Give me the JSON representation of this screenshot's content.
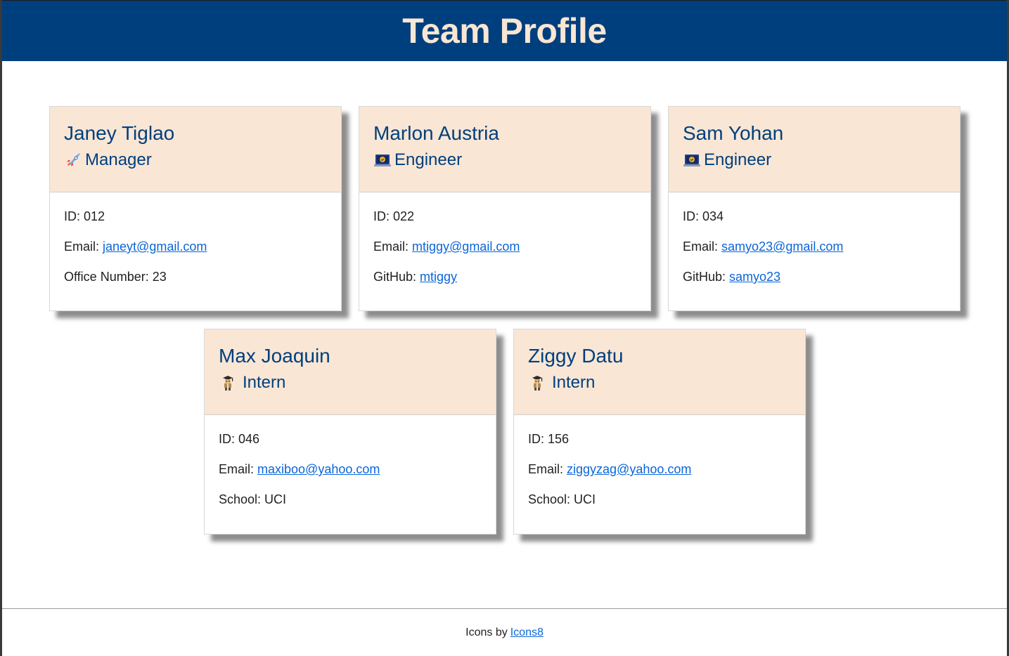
{
  "header": {
    "title": "Team Profile"
  },
  "cards": [
    {
      "name": "Janey Tiglao",
      "role": "Manager",
      "icon": "rocket-icon",
      "id_label": "ID: ",
      "id": "012",
      "email_label": "Email: ",
      "email": "janeyt@gmail.com",
      "extra_label": "Office Number: ",
      "extra": "23"
    },
    {
      "name": "Marlon Austria",
      "role": "Engineer",
      "icon": "laptop-icon",
      "id_label": "ID: ",
      "id": "022",
      "email_label": "Email: ",
      "email": "mtiggy@gmail.com",
      "extra_label": "GitHub: ",
      "extra": "mtiggy"
    },
    {
      "name": "Sam Yohan",
      "role": "Engineer",
      "icon": "laptop-icon",
      "id_label": "ID: ",
      "id": "034",
      "email_label": "Email: ",
      "email": "samyo23@gmail.com",
      "extra_label": "GitHub: ",
      "extra": "samyo23"
    },
    {
      "name": "Max Joaquin",
      "role": "Intern",
      "icon": "graduate-icon",
      "id_label": "ID: ",
      "id": "046",
      "email_label": "Email: ",
      "email": "maxiboo@yahoo.com",
      "extra_label": "School: ",
      "extra": "UCI"
    },
    {
      "name": "Ziggy Datu",
      "role": "Intern",
      "icon": "graduate-icon",
      "id_label": "ID: ",
      "id": "156",
      "email_label": "Email: ",
      "email": "ziggyzag@yahoo.com",
      "extra_label": "School: ",
      "extra": "UCI"
    }
  ],
  "footer": {
    "text": "Icons by",
    "link": "Icons8"
  },
  "colors": {
    "header_bg": "#003f7d",
    "header_text": "#f9e6d3",
    "card_head_bg": "#f9e6d5",
    "link": "#0a66d8"
  }
}
